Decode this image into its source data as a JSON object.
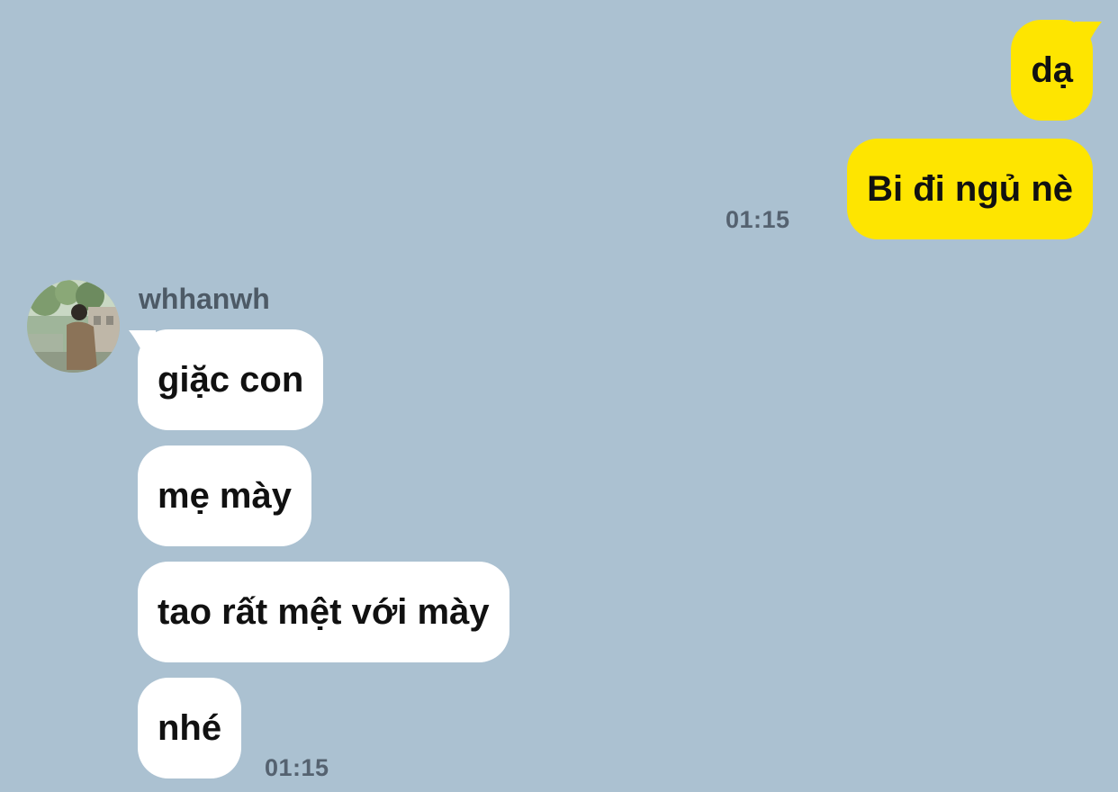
{
  "chat": {
    "outgoing": [
      {
        "text": "dạ"
      },
      {
        "text": "Bi đi ngủ nè"
      }
    ],
    "outgoing_time": "01:15",
    "incoming": {
      "sender": "whhanwh",
      "avatar_icon": "profile-photo-icon",
      "messages": [
        {
          "text": "giặc con"
        },
        {
          "text": "mẹ mày"
        },
        {
          "text": "tao rất mệt với mày"
        },
        {
          "text": "nhé"
        }
      ],
      "time": "01:15"
    }
  },
  "colors": {
    "background": "#abc1d1",
    "outgoing_bubble": "#fee500",
    "incoming_bubble": "#ffffff",
    "timestamp": "#556270",
    "sender_name": "#4d5a66"
  }
}
